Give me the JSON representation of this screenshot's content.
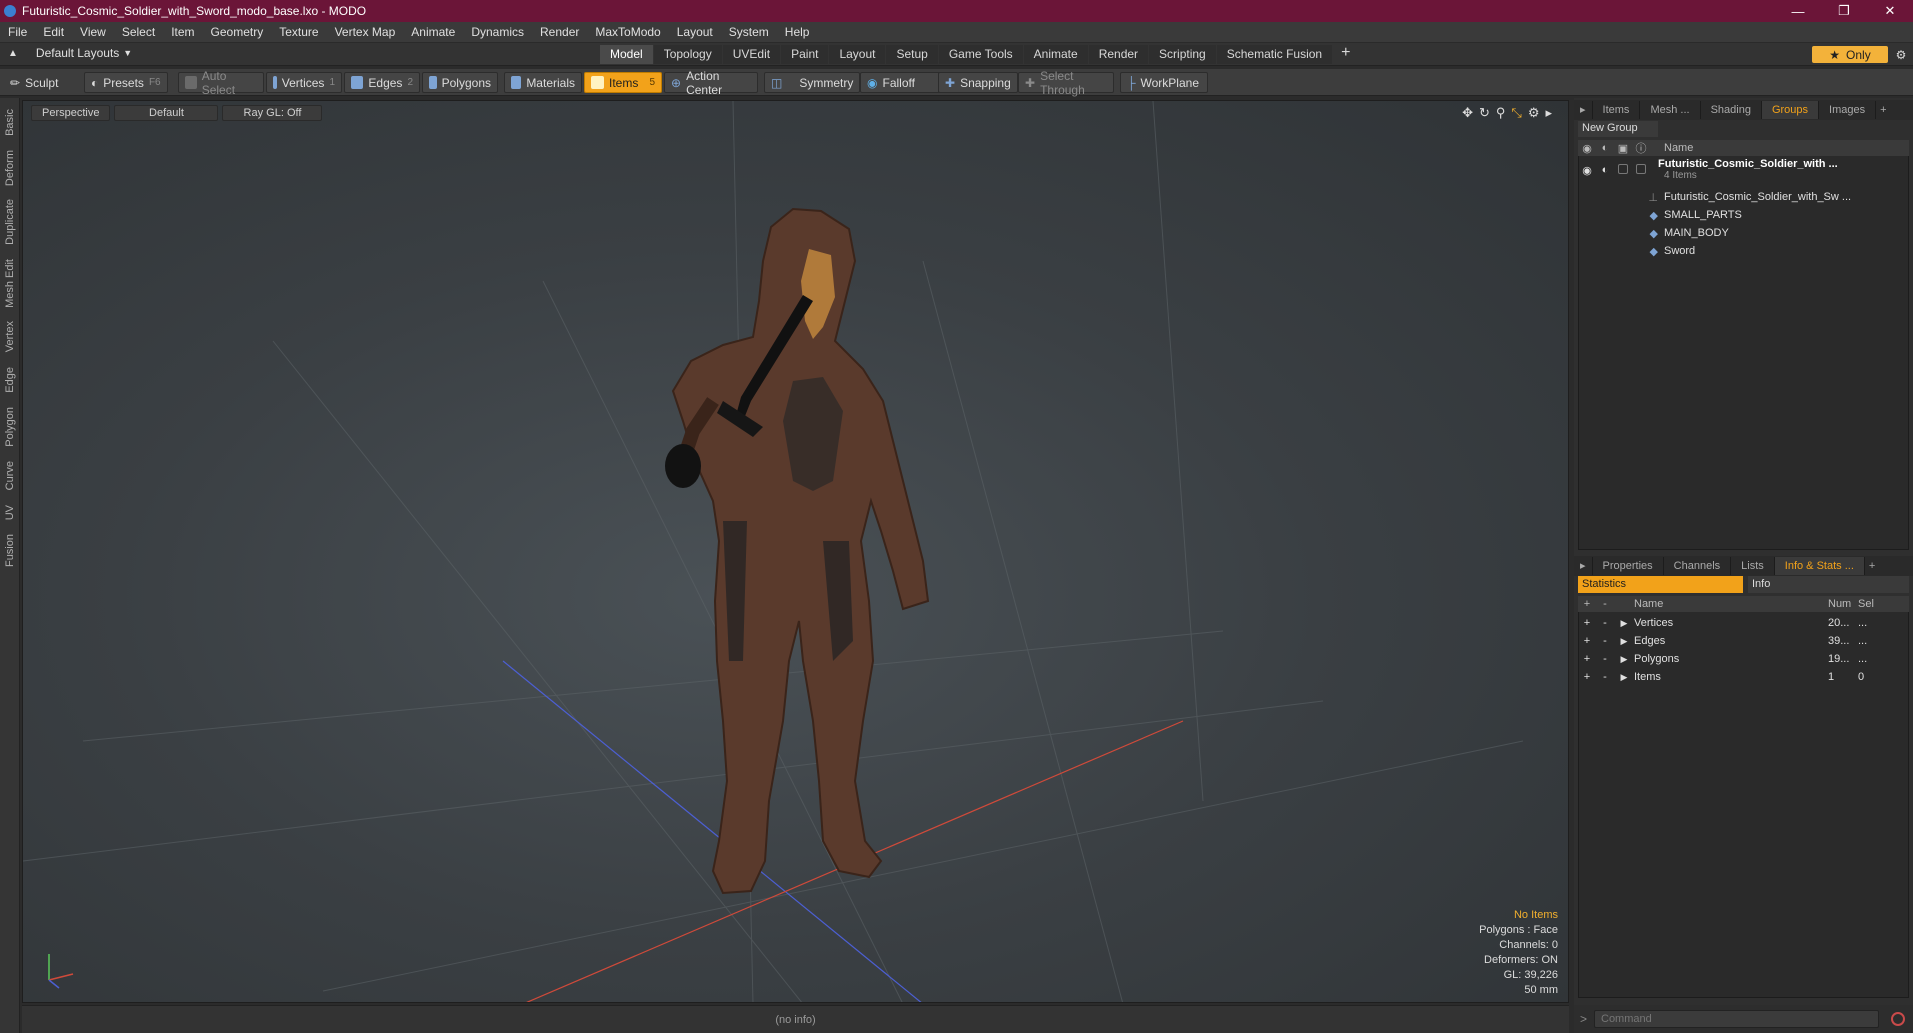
{
  "window": {
    "title": "Futuristic_Cosmic_Soldier_with_Sword_modo_base.lxo - MODO",
    "minimize": "—",
    "maximize": "❐",
    "close": "✕"
  },
  "menu": [
    "File",
    "Edit",
    "View",
    "Select",
    "Item",
    "Geometry",
    "Texture",
    "Vertex Map",
    "Animate",
    "Dynamics",
    "Render",
    "MaxToModo",
    "Layout",
    "System",
    "Help"
  ],
  "layout": {
    "selector": "Default Layouts",
    "tabs": [
      "Model",
      "Topology",
      "UVEdit",
      "Paint",
      "Layout",
      "Setup",
      "Game Tools",
      "Animate",
      "Render",
      "Scripting",
      "Schematic Fusion"
    ],
    "active_tab": "Model",
    "only_label": "Only"
  },
  "toolbar": {
    "sculpt": "Sculpt",
    "presets": "Presets",
    "presets_key": "F6",
    "auto_select": "Auto Select",
    "vertices": "Vertices",
    "vertices_key": "1",
    "edges": "Edges",
    "edges_key": "2",
    "polygons": "Polygons",
    "materials": "Materials",
    "items": "Items",
    "items_key": "5",
    "action_center": "Action Center",
    "symmetry": "Symmetry",
    "falloff": "Falloff",
    "snapping": "Snapping",
    "select_through": "Select Through",
    "workplane": "WorkPlane"
  },
  "left_tabs": [
    "Basic",
    "Deform",
    "Duplicate",
    "Mesh Edit",
    "Vertex",
    "Edge",
    "Polygon",
    "Curve",
    "UV",
    "Fusion"
  ],
  "viewport": {
    "view": "Perspective",
    "shading": "Default",
    "raygl": "Ray GL: Off",
    "info": {
      "no_items": "No Items",
      "polygons": "Polygons : Face",
      "channels": "Channels: 0",
      "deformers": "Deformers: ON",
      "gl": "GL: 39,226",
      "scale": "50 mm"
    }
  },
  "status": "(no info)",
  "item_panel": {
    "tabs": [
      "Items",
      "Mesh ...",
      "Shading",
      "Groups",
      "Images"
    ],
    "active_tab": "Groups",
    "new_group": "New Group",
    "name_col": "Name",
    "group": {
      "name": "Futuristic_Cosmic_Soldier_with ...",
      "count": "4 Items"
    },
    "children": [
      "Futuristic_Cosmic_Soldier_with_Sw ...",
      "SMALL_PARTS",
      "MAIN_BODY",
      "Sword"
    ]
  },
  "stats_panel": {
    "tabs": [
      "Properties",
      "Channels",
      "Lists",
      "Info & Stats ..."
    ],
    "active_tab": "Info & Stats ...",
    "statistics": "Statistics",
    "info": "Info",
    "cols": {
      "name": "Name",
      "num": "Num",
      "sel": "Sel"
    },
    "rows": [
      {
        "name": "Vertices",
        "num": "20...",
        "sel": "..."
      },
      {
        "name": "Edges",
        "num": "39...",
        "sel": "..."
      },
      {
        "name": "Polygons",
        "num": "19...",
        "sel": "..."
      },
      {
        "name": "Items",
        "num": "1",
        "sel": "0"
      }
    ]
  },
  "command": {
    "placeholder": "Command"
  }
}
